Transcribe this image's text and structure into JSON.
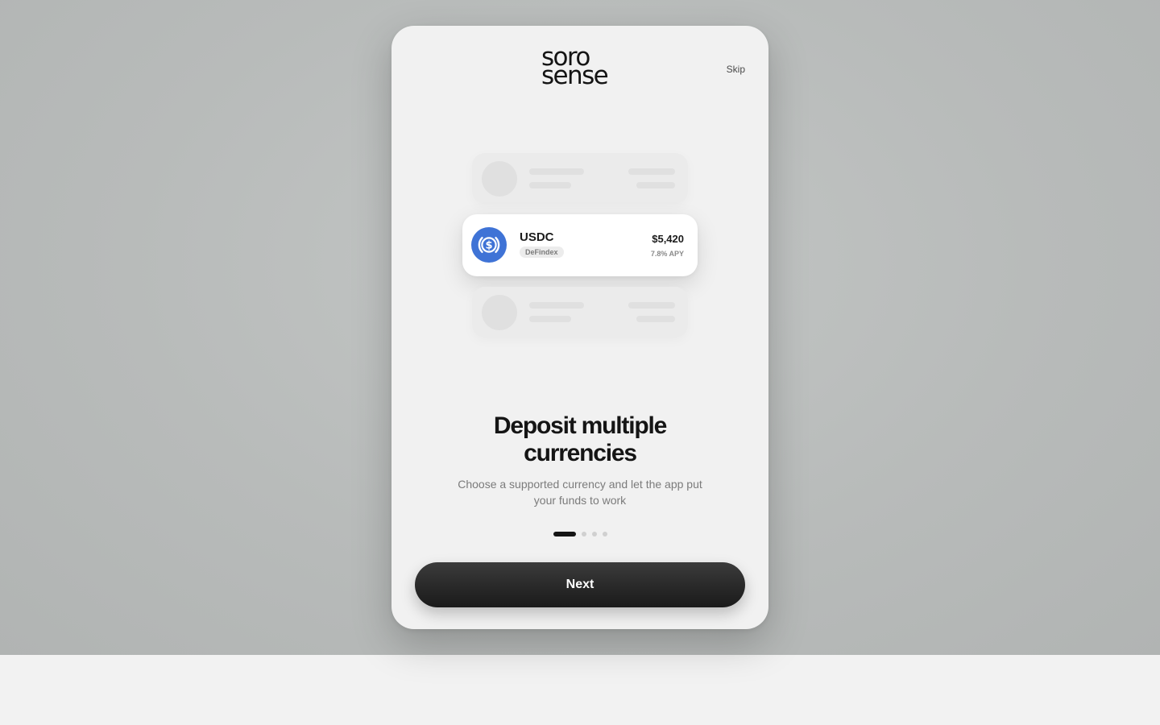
{
  "brand": {
    "logo_line1": "soro",
    "logo_line2": "sense"
  },
  "header": {
    "skip_label": "Skip"
  },
  "asset_card": {
    "coin_icon": "usdc-icon",
    "coin_color": "#3f73d6",
    "name": "USDC",
    "tag": "DeFindex",
    "amount": "$5,420",
    "apy": "7.8% APY"
  },
  "onboarding": {
    "title_line1": "Deposit multiple",
    "title_line2": "currencies",
    "subtitle_line1": "Choose a supported currency and let the app put",
    "subtitle_line2": "your funds to work",
    "total_steps": 4,
    "current_step": 1
  },
  "actions": {
    "next_label": "Next"
  }
}
